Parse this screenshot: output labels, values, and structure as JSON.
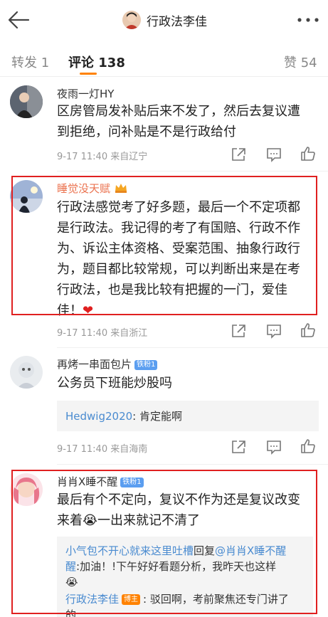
{
  "header": {
    "title": "行政法李佳",
    "back_icon": "arrow-left-icon",
    "more_icon": "more-dots-icon"
  },
  "tabs": {
    "repost": "转发 1",
    "comments": "评论 138",
    "likes": "赞 54"
  },
  "comments": [
    {
      "username": "夜雨一灯HY",
      "text_lines": [
        "区房管局发补贴后来不发了，然后去复议遭",
        "到拒绝，问补贴是不是行政给付"
      ],
      "meta": "9-17 11:40  来自辽宁"
    },
    {
      "username": "睡觉没天赋",
      "text_lines": [
        "行政法感觉考了好多题，最后一个不定项都",
        "是行政法。我记得的考了有国赔、行政不作",
        "为、诉讼主体资格、受案范围、抽象行政行",
        "为，题目都比较常规，可以判断出来是在考",
        "行政法，也是我比较有把握的一门，爱佳",
        "佳！"
      ],
      "heart": "❤",
      "meta": "9-17 11:40  来自浙江"
    },
    {
      "username": "再烤一串面包片",
      "badge": "铁粉1",
      "text_lines": [
        "公务员下班能炒股吗"
      ],
      "reply_user": "Hedwig2020",
      "reply_text": ": 肯定能啊",
      "meta": "9-17 11:40  来自海南"
    },
    {
      "username": "肖肖X睡不醒",
      "badge": "铁粉1",
      "text_lines": [
        "最后有个不定向，复议不作为还是复议改变",
        "来着😭一出来就记不清了"
      ],
      "reply1_user": "小气包不开心就来这里吐槽",
      "reply1_mid": "回复",
      "reply1_at": "@肖肖X睡不醒",
      "reply1_line2_a": "醒",
      "reply1_line2_b": ":加油！!下午好好看题分析，我昨天也这样",
      "reply1_line3": "😭",
      "reply2_user": "行政法李佳",
      "reply2_badge": "博主",
      "reply2_text": ": 驳回啊，考前聚焦还专门讲了",
      "reply2_tail": "的"
    }
  ],
  "colors": {
    "accent_orange": "#ff8200",
    "link_blue": "#4a8bd0",
    "highlight_red": "#e02020"
  }
}
